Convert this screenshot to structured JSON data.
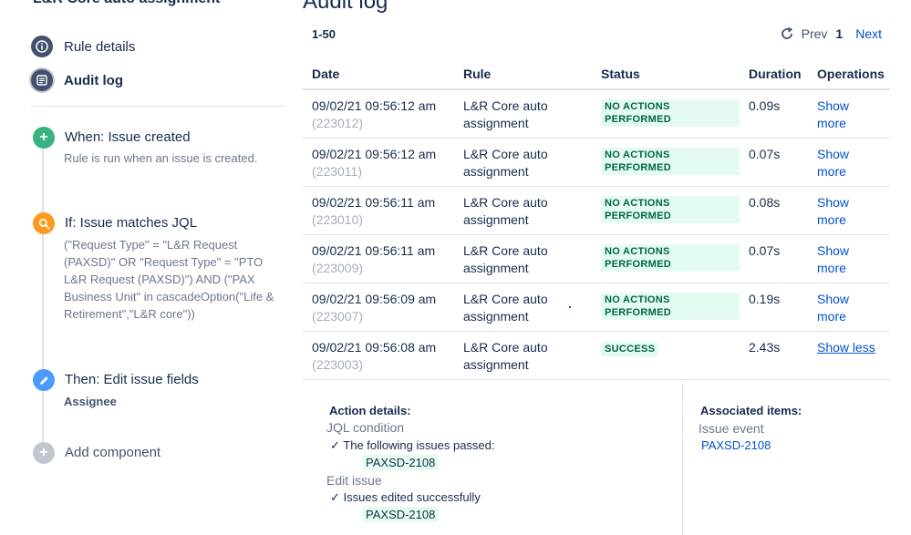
{
  "sidebar": {
    "title": "L&R Core auto assignment",
    "nav": [
      {
        "label": "Rule details"
      },
      {
        "label": "Audit log"
      }
    ],
    "components": {
      "trigger": {
        "title": "When: Issue created",
        "desc": "Rule is run when an issue is created."
      },
      "condition": {
        "title": "If: Issue matches JQL",
        "lines": [
          "(\"Request Type\" = \"L&R Request",
          "(PAXSD)\" OR \"Request Type\" = \"PTO",
          "L&R Request (PAXSD)\") AND (\"PAX",
          "Business Unit\" in cascadeOption(\"Life &",
          "Retirement\",\"L&R core\"))"
        ]
      },
      "action": {
        "title": "Then: Edit issue fields",
        "desc": "Assignee"
      },
      "add": {
        "title": "Add component"
      }
    }
  },
  "main": {
    "title": "Audit log",
    "range": "1-50",
    "pager": {
      "prev": "Prev",
      "current": "1",
      "next": "Next"
    },
    "columns": [
      "Date",
      "Rule",
      "Status",
      "Duration",
      "Operations"
    ],
    "rows": [
      {
        "date": "09/02/21 09:56:12 am",
        "id": "(223012)",
        "rule1": "L&R Core auto",
        "rule2": "assignment",
        "status": "NO ACTIONS PERFORMED",
        "duration": "0.09s",
        "op1": "Show",
        "op2": "more"
      },
      {
        "date": "09/02/21 09:56:12 am",
        "id": "(223011)",
        "rule1": "L&R Core auto",
        "rule2": "assignment",
        "status": "NO ACTIONS PERFORMED",
        "duration": "0.07s",
        "op1": "Show",
        "op2": "more"
      },
      {
        "date": "09/02/21 09:56:11 am",
        "id": "(223010)",
        "rule1": "L&R Core auto",
        "rule2": "assignment",
        "status": "NO ACTIONS PERFORMED",
        "duration": "0.08s",
        "op1": "Show",
        "op2": "more"
      },
      {
        "date": "09/02/21 09:56:11 am",
        "id": "(223009)",
        "rule1": "L&R Core auto",
        "rule2": "assignment",
        "status": "NO ACTIONS PERFORMED",
        "duration": "0.07s",
        "op1": "Show",
        "op2": "more"
      },
      {
        "date": "09/02/21 09:56:09 am",
        "id": "(223007)",
        "rule1": "L&R Core auto",
        "rule2": "assignment",
        "status": "NO ACTIONS PERFORMED",
        "duration": "0.19s",
        "op1": "Show",
        "op2": "more"
      },
      {
        "date": "09/02/21 09:56:08 am",
        "id": "(223003)",
        "rule1": "L&R Core auto",
        "rule2": "assignment",
        "status": "SUCCESS",
        "duration": "2.43s",
        "op1": "Show less",
        "op2": ""
      }
    ],
    "details": {
      "action_heading": "Action details:",
      "jql_label": "JQL condition",
      "jql_check": "The following issues passed:",
      "jql_issue": "PAXSD-2108",
      "edit_label": "Edit issue",
      "edit_check": "Issues edited successfully",
      "edit_issue": "PAXSD-2108",
      "assoc_heading": "Associated items:",
      "assoc_label": "Issue event",
      "assoc_issue": "PAXSD-2108"
    }
  },
  "colors": {
    "link": "#0052cc",
    "lozenge_bg": "#e3fcef",
    "lozenge_text": "#006644",
    "trigger_green": "#36b37e",
    "condition_orange": "#ff991f",
    "action_blue": "#4c9aff",
    "add_grey": "#c1c7d0",
    "nav_icon": "#42526e"
  },
  "icons": {
    "rule_details": "info-icon",
    "audit_log": "list-icon",
    "trigger": "plus-icon",
    "condition": "search-icon",
    "action": "pencil-icon",
    "add": "plus-icon",
    "refresh": "refresh-icon",
    "check": "check-icon"
  }
}
